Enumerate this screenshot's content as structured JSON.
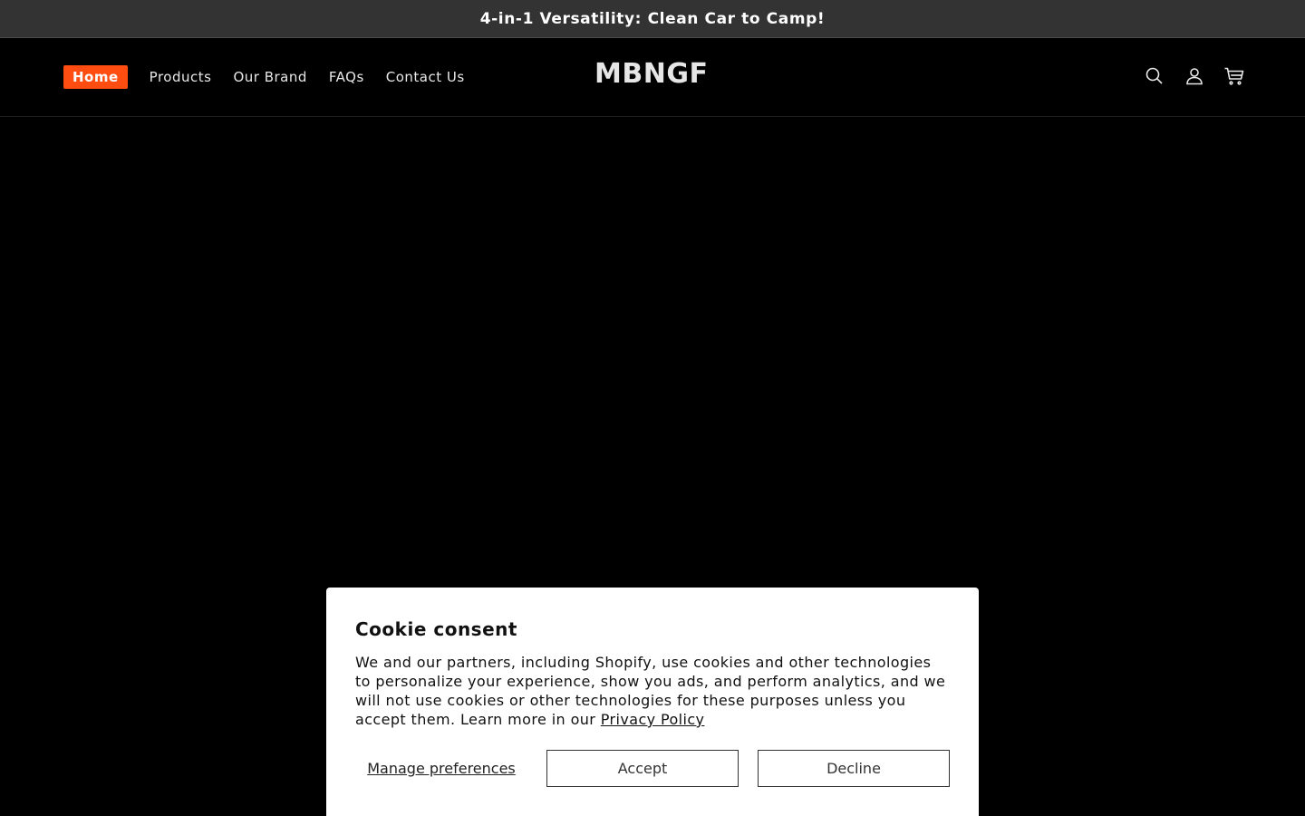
{
  "announcement": {
    "text": "4-in-1 Versatility: Clean Car to Camp!"
  },
  "header": {
    "logo": "MBNGF",
    "nav": [
      {
        "label": "Home",
        "active": true
      },
      {
        "label": "Products",
        "active": false
      },
      {
        "label": "Our Brand",
        "active": false
      },
      {
        "label": "FAQs",
        "active": false
      },
      {
        "label": "Contact Us",
        "active": false
      }
    ],
    "icons": [
      "search-icon",
      "account-icon",
      "cart-icon"
    ]
  },
  "cookie_banner": {
    "title": "Cookie consent",
    "body": "We and our partners, including Shopify, use cookies and other technologies to personalize your experience, show you ads, and perform analytics, and we will not use cookies or other technologies for these purposes unless you accept them. Learn more in our ",
    "link_label": "Privacy Policy",
    "manage_label": "Manage preferences",
    "accept_label": "Accept",
    "decline_label": "Decline"
  },
  "colors": {
    "accent": "#ff4d12",
    "announcement_bg": "#333333",
    "page_bg": "#000000"
  }
}
